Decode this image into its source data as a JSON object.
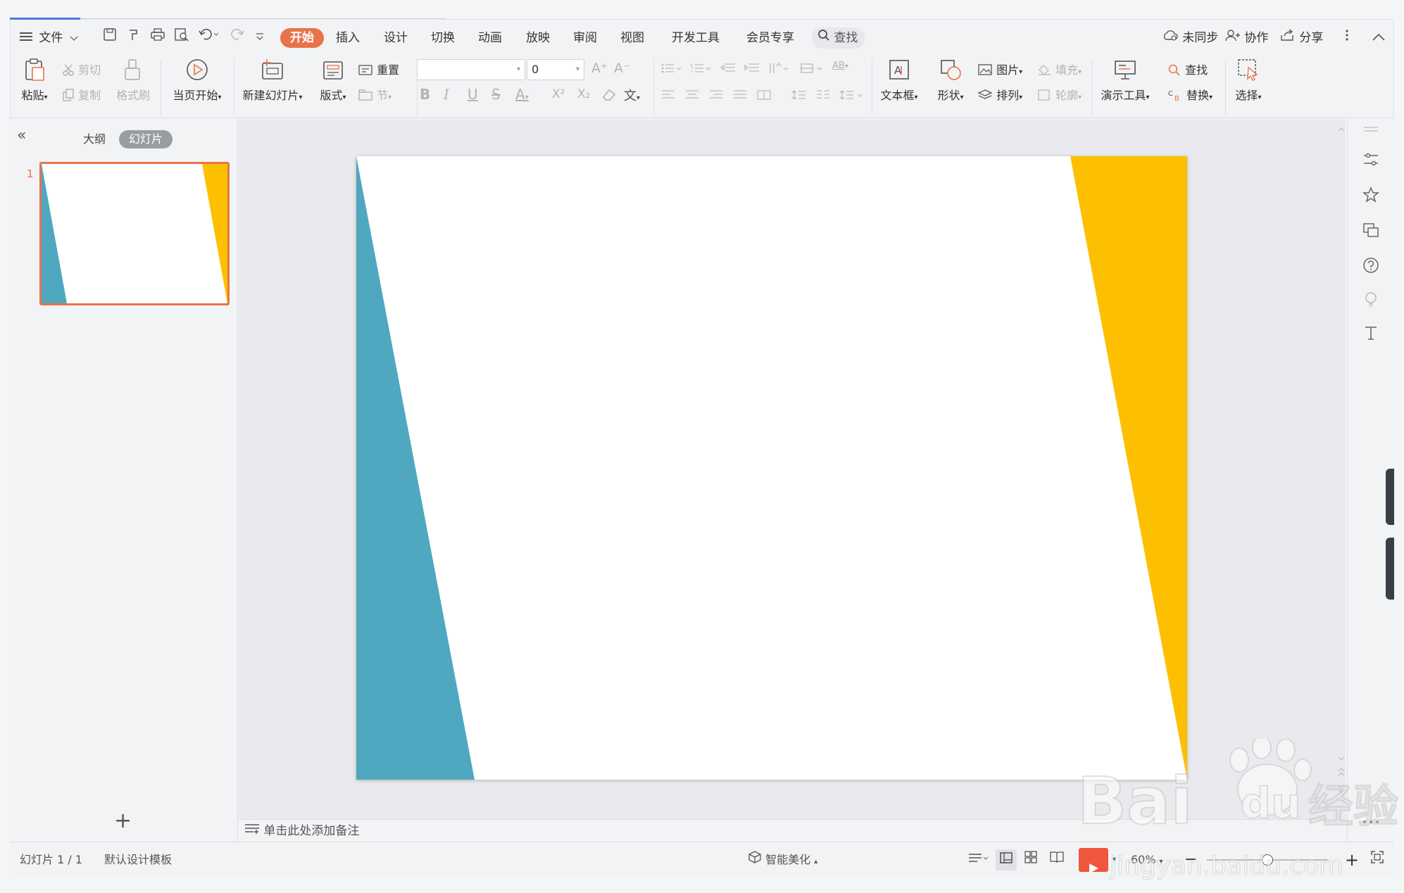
{
  "menu": {
    "file_label": "文件",
    "tabs": [
      "开始",
      "插入",
      "设计",
      "切换",
      "动画",
      "放映",
      "审阅",
      "视图",
      "开发工具",
      "会员专享"
    ],
    "search_label": "查找",
    "sync_label": "未同步",
    "collab_label": "协作",
    "share_label": "分享"
  },
  "ribbon": {
    "paste": "粘贴",
    "cut": "剪切",
    "copy": "复制",
    "format_painter": "格式刷",
    "play_current": "当页开始",
    "new_slide": "新建幻灯片",
    "layout": "版式",
    "reset": "重置",
    "section": "节",
    "font_size_value": "0",
    "text_box": "文本框",
    "shape": "形状",
    "picture": "图片",
    "fill": "填充",
    "arrange": "排列",
    "outline": "轮廓",
    "presentation_tools": "演示工具",
    "find": "查找",
    "replace": "替换",
    "select": "选择",
    "glyphs": {
      "bold": "B",
      "italic": "I",
      "underline": "U",
      "strike": "S",
      "font_color": "A",
      "superscript": "X²",
      "subscript": "X₂",
      "inc_font": "A⁺",
      "dec_font": "A⁻",
      "phonetic": "文",
      "text_dir": "AB"
    }
  },
  "left_panel": {
    "collapse_glyph": "«",
    "outline_tab": "大纲",
    "slides_tab": "幻灯片",
    "slide_number": "1",
    "add_glyph": "+"
  },
  "notes": {
    "placeholder": "单击此处添加备注"
  },
  "status": {
    "slide_counter": "幻灯片 1 / 1",
    "template": "默认设计模板",
    "smart_beautify": "智能美化",
    "zoom": "60%",
    "zoom_minus": "−",
    "zoom_plus": "+",
    "zoom_level": 0.5
  },
  "colors": {
    "accent_tab": "#e8734a",
    "slide_teal": "#4fa8c0",
    "slide_yellow": "#fdc000",
    "selection": "#e8734a"
  },
  "icons": {
    "menu": "hamburger-icon",
    "save": "save-icon",
    "print": "print-icon",
    "undo": "undo-icon",
    "redo": "redo-icon",
    "more": "more-vertical-icon",
    "collapse": "chevron-up-icon"
  },
  "watermark": {
    "brand": "Bai",
    "brand2": "du",
    "cn": "经验",
    "url": "jingyan.baidu.com"
  }
}
